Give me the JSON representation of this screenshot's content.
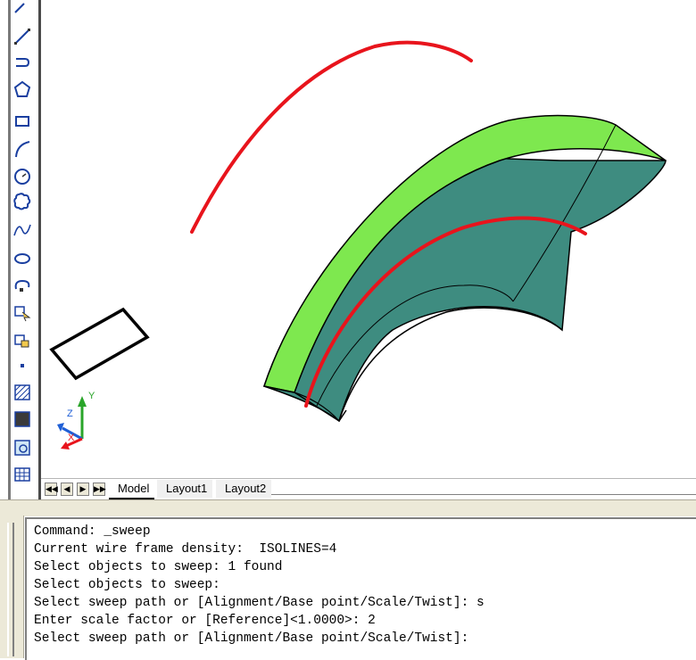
{
  "toolbar": {
    "tools": [
      {
        "icon": "line-icon"
      },
      {
        "icon": "construction-line-icon"
      },
      {
        "icon": "polyline-icon"
      },
      {
        "icon": "polygon-icon"
      },
      {
        "icon": "rectangle-icon"
      },
      {
        "icon": "arc-icon"
      },
      {
        "icon": "circle-icon"
      },
      {
        "icon": "revision-cloud-icon"
      },
      {
        "icon": "spline-icon"
      },
      {
        "icon": "ellipse-icon"
      },
      {
        "icon": "ellipse-arc-icon"
      },
      {
        "icon": "insert-block-icon"
      },
      {
        "icon": "make-block-icon"
      },
      {
        "icon": "point-icon"
      },
      {
        "icon": "hatch-icon"
      },
      {
        "icon": "gradient-icon"
      },
      {
        "icon": "region-icon"
      },
      {
        "icon": "table-icon"
      }
    ]
  },
  "ucs": {
    "x_label": "X",
    "y_label": "Y",
    "z_label": "Z"
  },
  "tabs": {
    "model": "Model",
    "layout1": "Layout1",
    "layout2": "Layout2"
  },
  "colors": {
    "path_curve": "#e8141c",
    "swept_top": "#7ee84f",
    "swept_side": "#3e8c80",
    "profile": "#000000"
  },
  "command": {
    "lines": [
      "Command: _sweep",
      "Current wire frame density:  ISOLINES=4",
      "Select objects to sweep: 1 found",
      "Select objects to sweep:",
      "Select sweep path or [Alignment/Base point/Scale/Twist]: s",
      "Enter scale factor or [Reference]<1.0000>: 2",
      "Select sweep path or [Alignment/Base point/Scale/Twist]:"
    ]
  }
}
